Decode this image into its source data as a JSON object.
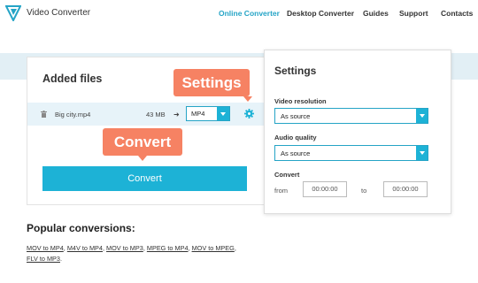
{
  "header": {
    "brand": "Video Converter",
    "nav": {
      "online": "Online Converter",
      "desktop": "Desktop Converter",
      "guides": "Guides",
      "support": "Support",
      "contacts": "Contacts"
    }
  },
  "added_files": {
    "title": "Added files",
    "file": {
      "name": "Big city.mp4",
      "size": "43 MB",
      "format": "MP4"
    }
  },
  "callouts": {
    "settings": "Settings",
    "convert": "Convert"
  },
  "convert_button": "Convert",
  "settings": {
    "title": "Settings",
    "video_resolution_label": "Video resolution",
    "video_resolution_value": "As source",
    "audio_quality_label": "Audio quality",
    "audio_quality_value": "As source",
    "convert_label": "Convert",
    "from_label": "from",
    "from_value": "00:00:00",
    "to_label": "to",
    "to_value": "00:00:00"
  },
  "popular": {
    "title": "Popular conversions:",
    "links": [
      "MOV to MP4",
      "M4V to MP4",
      "MOV to MP3",
      "MPEG to MP4",
      "MOV to MPEG",
      "FLV to MP3"
    ]
  },
  "colors": {
    "accent": "#1db2d6",
    "callout": "#f68263",
    "banner": "#e2eff5"
  }
}
